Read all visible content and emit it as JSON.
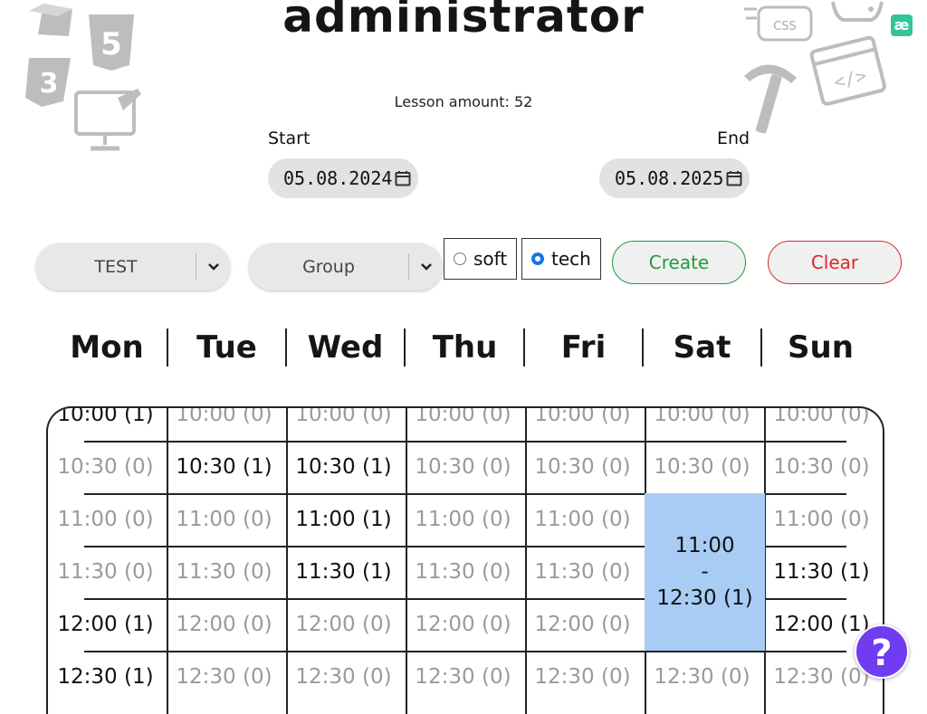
{
  "header": {
    "title": "administrator",
    "lesson_amount": "Lesson amount: 52"
  },
  "dates": {
    "start_label": "Start",
    "start_value": "05.08.2024",
    "end_label": "End",
    "end_value": "05.08.2025"
  },
  "controls": {
    "select1_value": "TEST",
    "select2_value": "Group",
    "radio_soft_label": "soft",
    "radio_tech_label": "tech",
    "radio_selected": "tech",
    "create_label": "Create",
    "clear_label": "Clear"
  },
  "days": [
    "Mon",
    "Tue",
    "Wed",
    "Thu",
    "Fri",
    "Sat",
    "Sun"
  ],
  "schedule": {
    "rows": [
      [
        "10:00 (1)",
        "10:00 (0)",
        "10:00 (0)",
        "10:00 (0)",
        "10:00 (0)",
        "10:00 (0)",
        "10:00 (0)"
      ],
      [
        "10:30 (0)",
        "10:30 (1)",
        "10:30 (1)",
        "10:30 (0)",
        "10:30 (0)",
        "10:30 (0)",
        "10:30 (0)"
      ],
      [
        "11:00 (0)",
        "11:00 (0)",
        "11:00 (1)",
        "11:00 (0)",
        "11:00 (0)",
        "",
        "11:00 (0)"
      ],
      [
        "11:30 (0)",
        "11:30 (0)",
        "11:30 (1)",
        "11:30 (0)",
        "11:30 (0)",
        "",
        "11:30 (1)"
      ],
      [
        "12:00 (1)",
        "12:00 (0)",
        "12:00 (0)",
        "12:00 (0)",
        "12:00 (0)",
        "",
        "12:00 (1)"
      ],
      [
        "12:30 (1)",
        "12:30 (0)",
        "12:30 (0)",
        "12:30 (0)",
        "12:30 (0)",
        "12:30 (0)",
        "12:30 (0)"
      ]
    ],
    "sat_block": {
      "start": "11:00",
      "dash": "-",
      "end": "12:30 (1)"
    }
  },
  "colors": {
    "accent_purple": "#6f3cf2",
    "create_green": "#1f9d3a",
    "clear_red": "#e0262b",
    "selected_block": "#a9ccf5",
    "radio_blue": "#1a73e8"
  },
  "icons": [
    "box-icon",
    "html5-icon",
    "css3-icon",
    "design-monitor-icon",
    "css-chat-icon",
    "gamepad-icon",
    "code-window-icon",
    "pickaxe-icon",
    "app-logo-icon",
    "calendar-icon",
    "chevron-down-icon",
    "help-icon"
  ]
}
